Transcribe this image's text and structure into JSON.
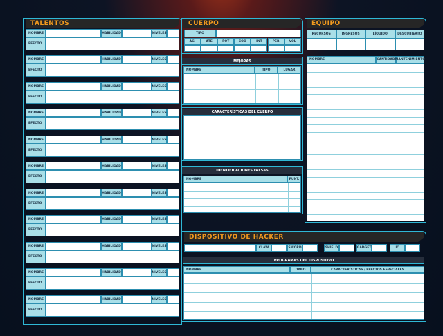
{
  "talentos": {
    "title": "TALENTOS",
    "nombre": "NOMBRE",
    "habilidad": "HABILIDAD",
    "niveles": "NIVELES",
    "efecto": "EFECTO"
  },
  "cuerpo": {
    "title": "CUERPO",
    "tipo": "TIPO",
    "stats": [
      "AGI",
      "ATE",
      "POT",
      "COO",
      "INT",
      "PER",
      "VOL"
    ],
    "mejoras": {
      "title": "MEJORAS",
      "columns": [
        "NOMBRE",
        "TIPO",
        "LUGAR"
      ]
    },
    "caracteristicas": "CARACTERÍSTICAS DEL CUERPO",
    "identificaciones": {
      "title": "IDENTIFICACIONES FALSAS",
      "columns": [
        "NOMBRE",
        "PUNT."
      ]
    }
  },
  "equipo": {
    "title": "EQUIPO",
    "top": [
      "RECURSOS",
      "INGRESOS",
      "LÍQUIDO",
      "DESCUBIERTO"
    ],
    "columns": [
      "NOMBRE",
      "CANTIDAD",
      "MANTENIMIENTO"
    ]
  },
  "hacker": {
    "title": "DISPOSITIVO DE HACKER",
    "stats": [
      "CLAW",
      "SWORD",
      "SHIELD",
      "GADGET",
      "IC"
    ],
    "programas": {
      "title": "PROGRAMAS DEL DISPOSITIVO",
      "columns": [
        "NOMBRE",
        "DAÑO",
        "CARACTERÍSTICAS / EFECTOS ESPECIALES"
      ]
    }
  },
  "colors": {
    "accent": "#2fb8d6",
    "header_text": "#f29a1e",
    "label_bg": "#a9dfe8"
  }
}
